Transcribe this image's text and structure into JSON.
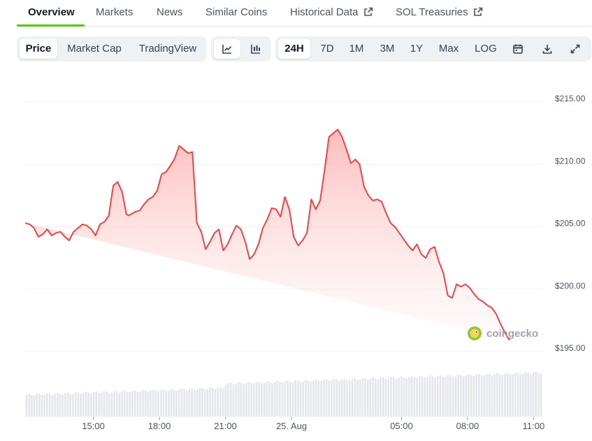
{
  "tabs": [
    {
      "label": "Overview",
      "active": true
    },
    {
      "label": "Markets"
    },
    {
      "label": "News"
    },
    {
      "label": "Similar Coins"
    },
    {
      "label": "Historical Data",
      "external": true
    },
    {
      "label": "SOL Treasuries",
      "external": true
    }
  ],
  "toolbar": {
    "chart_types": [
      "Price",
      "Market Cap",
      "TradingView"
    ],
    "chart_type_selected": "Price",
    "style_icons": [
      "line-chart-icon",
      "candlestick-chart-icon"
    ],
    "style_selected": "line-chart-icon",
    "ranges": [
      "24H",
      "7D",
      "1M",
      "3M",
      "1Y",
      "Max",
      "LOG"
    ],
    "range_selected": "24H",
    "tool_icons": [
      "calendar-icon",
      "download-icon",
      "expand-icon"
    ]
  },
  "watermark": "coingecko",
  "colors": {
    "line": "#ef4444",
    "fill": "#fecaca",
    "accent": "#4bcc00",
    "volume": "#e5e7eb"
  },
  "chart_data": {
    "type": "area",
    "ylim": [
      195,
      215
    ],
    "y_ticks": [
      "$215.00",
      "$210.00",
      "$205.00",
      "$200.00",
      "$195.00"
    ],
    "y_tick_values": [
      215,
      210,
      205,
      200,
      195
    ],
    "x_ticks": [
      "15:00",
      "18:00",
      "21:00",
      "25. Aug",
      "05:00",
      "08:00",
      "11:00"
    ],
    "x_tick_hours": [
      3,
      6,
      9,
      12,
      17,
      20,
      23
    ],
    "x_range_hours": [
      -0.1,
      23.4
    ],
    "grid": true,
    "series": [
      {
        "x_hours": [
          -0.1,
          0.1,
          0.3,
          0.5,
          0.7,
          0.9,
          1.1,
          1.3,
          1.5,
          1.7,
          1.9,
          2.1,
          2.3,
          2.5,
          2.7,
          2.9,
          3.1,
          3.3,
          3.5,
          3.7,
          3.9,
          4.1,
          4.3,
          4.5,
          4.6,
          4.7,
          4.9,
          5.1,
          5.3,
          5.5,
          5.7,
          5.9,
          6.1,
          6.3,
          6.5,
          6.7,
          6.9,
          7.1,
          7.3,
          7.5,
          7.7,
          7.9,
          8.1,
          8.3,
          8.5,
          8.7,
          8.9,
          9.1,
          9.3,
          9.5,
          9.7,
          9.9,
          10.1,
          10.3,
          10.5,
          10.7,
          10.9,
          11.1,
          11.3,
          11.5,
          11.7,
          11.9,
          12.1,
          12.3,
          12.5,
          12.7,
          12.9,
          13.1,
          13.3,
          13.5,
          13.7,
          13.9,
          14.1,
          14.3,
          14.5,
          14.7,
          14.9,
          15.1,
          15.3,
          15.5,
          15.7,
          15.9,
          16.1,
          16.3,
          16.5,
          16.7,
          16.9,
          17.1,
          17.3,
          17.5,
          17.7,
          17.9,
          18.1,
          18.3,
          18.5,
          18.7,
          18.9,
          19.1,
          19.3,
          19.5,
          19.7,
          19.9,
          20.1,
          20.3,
          20.5,
          20.7,
          20.9,
          21.1,
          21.3,
          21.5,
          21.7,
          21.9,
          22.1,
          22.3,
          22.5,
          22.7,
          22.9,
          23.1,
          23.3,
          23.4
        ],
        "values": [
          205.3,
          205.2,
          204.9,
          204.2,
          204.4,
          204.8,
          204.3,
          204.5,
          204.6,
          204.2,
          203.9,
          204.6,
          204.9,
          205.2,
          205.1,
          204.8,
          204.3,
          205.2,
          205.4,
          205.9,
          208.3,
          208.6,
          207.8,
          206.0,
          205.9,
          206.0,
          206.2,
          206.3,
          206.8,
          207.2,
          207.4,
          207.9,
          209.2,
          209.4,
          209.9,
          210.5,
          211.5,
          211.2,
          210.9,
          211.0,
          205.3,
          204.6,
          203.2,
          203.8,
          204.5,
          204.8,
          203.1,
          203.6,
          204.4,
          205.1,
          204.8,
          203.8,
          202.4,
          202.8,
          203.6,
          204.9,
          205.6,
          206.5,
          206.4,
          205.8,
          207.4,
          206.4,
          204.2,
          203.5,
          203.9,
          204.5,
          207.2,
          206.4,
          207.1,
          209.5,
          212.2,
          212.5,
          212.8,
          212.2,
          211.2,
          210.1,
          210.4,
          210.0,
          208.2,
          207.5,
          207.1,
          207.2,
          207.0,
          206.1,
          205.3,
          205.0,
          204.5,
          204.0,
          203.5,
          203.1,
          203.6,
          202.8,
          202.5,
          203.2,
          203.4,
          202.2,
          201.3,
          199.5,
          199.3,
          200.4,
          200.2,
          200.4,
          200.1,
          199.6,
          199.2,
          199.0,
          198.7,
          198.5,
          198.0,
          197.2,
          196.5,
          195.9
        ]
      }
    ],
    "volume_bars": 200
  }
}
